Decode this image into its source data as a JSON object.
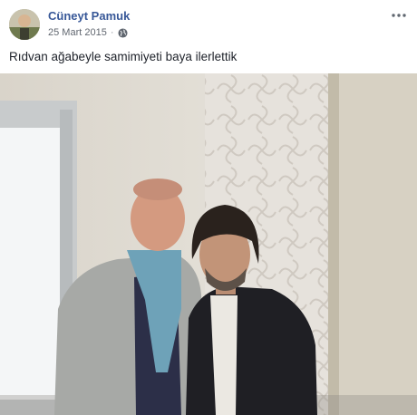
{
  "post": {
    "author_name": "Cüneyt Pamuk",
    "date": "25 Mart 2015",
    "separator": "·",
    "privacy_icon": "globe-icon",
    "more_icon": "more-options-icon",
    "caption": "Rıdvan ağabeyle samimiyeti baya ilerlettik"
  },
  "colors": {
    "author_link": "#385898",
    "meta_text": "#616770",
    "caption_text": "#1d2129"
  }
}
